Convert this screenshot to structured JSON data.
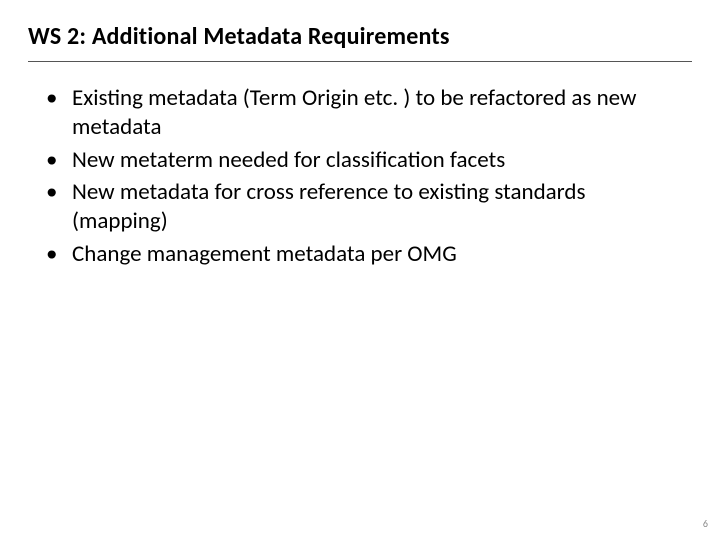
{
  "title": "WS 2: Additional Metadata Requirements",
  "bullets": [
    "Existing metadata (Term Origin etc. ) to be refactored as new metadata",
    "New metaterm needed for classification facets",
    "New metadata for cross reference to existing standards (mapping)",
    "Change management metadata per OMG"
  ],
  "page_number": "6"
}
